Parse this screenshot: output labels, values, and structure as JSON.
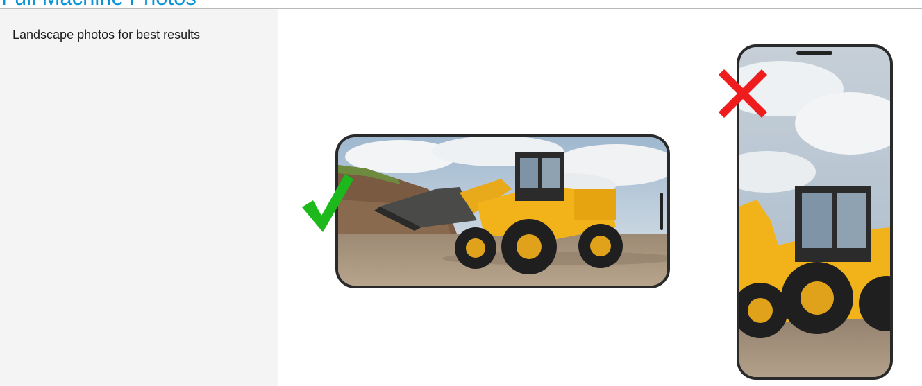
{
  "page": {
    "title": "Full Machine Photos"
  },
  "sidebar": {
    "label": "Landscape photos for best results"
  },
  "examples": {
    "correct": {
      "icon": "check-icon",
      "color": "#1cb81c"
    },
    "incorrect": {
      "icon": "close-icon",
      "color": "#ee1c1c"
    }
  },
  "colors": {
    "accent": "#0a94d6",
    "machine": "#f2b21a"
  }
}
